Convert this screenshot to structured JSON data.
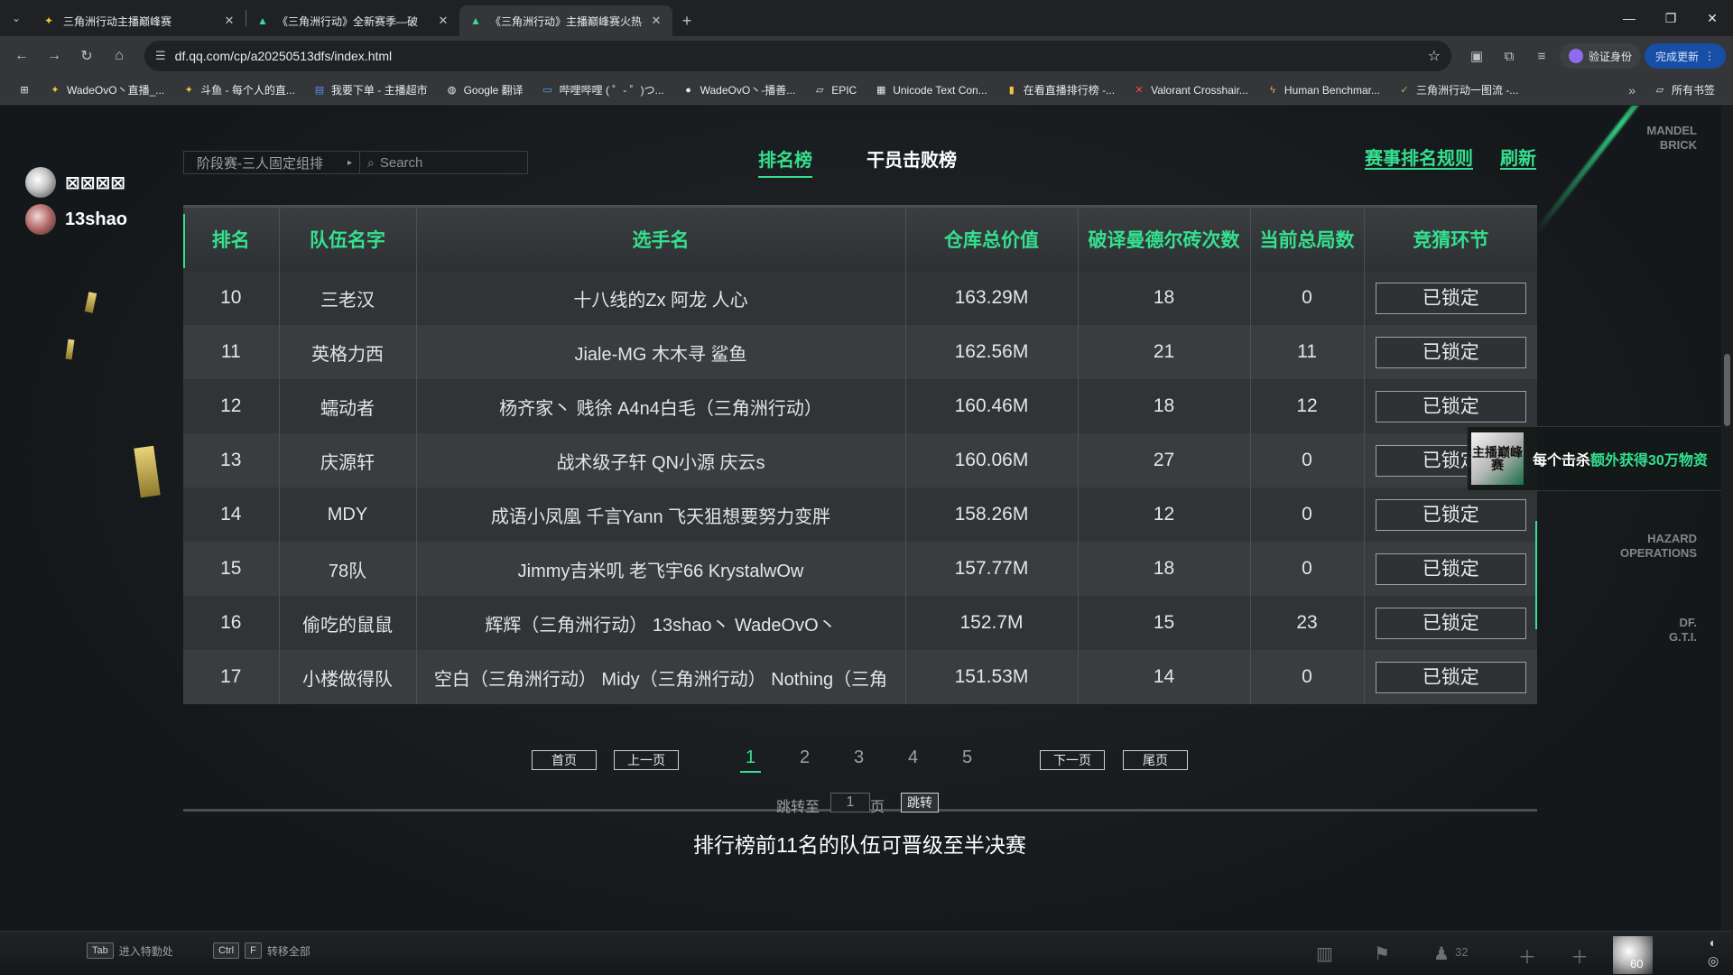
{
  "browser": {
    "tabs": [
      {
        "title": "三角洲行动主播巅峰赛",
        "active": false
      },
      {
        "title": "《三角洲行动》全新赛季—破",
        "active": false
      },
      {
        "title": "《三角洲行动》主播巅峰赛火热",
        "active": true
      }
    ],
    "url": "df.qq.com/cp/a20250513dfs/index.html",
    "profile_label": "验证身份",
    "update_label": "完成更新",
    "bookmarks": [
      "WadeOvO丶直播_...",
      "斗鱼 - 每个人的直...",
      "我要下单 - 主播超市",
      "Google 翻译",
      "哔哩哔哩 ( ゜- ゜)つ...",
      "WadeOvO丶-播善...",
      "EPIC",
      "Unicode Text Con...",
      "在看直播排行榜 -...",
      "Valorant Crosshair...",
      "Human Benchmar...",
      "三角洲行动一图流 -..."
    ],
    "bookmarks_folder": "所有书签"
  },
  "overlay": {
    "users": [
      "⊠⊠⊠⊠",
      "13shao"
    ]
  },
  "filter": {
    "select_label": "阶段赛-三人固定组排",
    "search_placeholder": "Search"
  },
  "tabs": {
    "leaderboard": "排名榜",
    "kills": "干员击败榜"
  },
  "links": {
    "rules": "赛事排名规则",
    "refresh": "刷新"
  },
  "table": {
    "headers": [
      "排名",
      "队伍名字",
      "选手名",
      "仓库总价值",
      "破译曼德尔砖次数",
      "当前总局数",
      "竞猜环节"
    ],
    "rows": [
      {
        "rank": "10",
        "team": "三老汉",
        "players": "十八线的Zx  阿龙  人心",
        "value": "163.29M",
        "bricks": "18",
        "games": "0",
        "status": "已锁定"
      },
      {
        "rank": "11",
        "team": "英格力西",
        "players": "Jiale-MG  木木寻  鲨鱼",
        "value": "162.56M",
        "bricks": "21",
        "games": "11",
        "status": "已锁定"
      },
      {
        "rank": "12",
        "team": "蠕动者",
        "players": "杨齐家丶  贱徐  A4n4白毛（三角洲行动）",
        "value": "160.46M",
        "bricks": "18",
        "games": "12",
        "status": "已锁定"
      },
      {
        "rank": "13",
        "team": "庆源轩",
        "players": "战术级子轩  QN小源  庆云s",
        "value": "160.06M",
        "bricks": "27",
        "games": "0",
        "status": "已锁定"
      },
      {
        "rank": "14",
        "team": "MDY",
        "players": "成语小凤凰  千言Yann  飞天狙想要努力变胖",
        "value": "158.26M",
        "bricks": "12",
        "games": "0",
        "status": "已锁定"
      },
      {
        "rank": "15",
        "team": "78队",
        "players": "Jimmy吉米叽  老飞宇66  KrystalwOw",
        "value": "157.77M",
        "bricks": "18",
        "games": "0",
        "status": "已锁定"
      },
      {
        "rank": "16",
        "team": "偷吃的鼠鼠",
        "players": "辉辉（三角洲行动）  13shao丶  WadeOvO丶",
        "value": "152.7M",
        "bricks": "15",
        "games": "23",
        "status": "已锁定"
      },
      {
        "rank": "17",
        "team": "小楼做得队",
        "players": "空白（三角洲行动）  Midy（三角洲行动）  Nothing（三角",
        "value": "151.53M",
        "bricks": "14",
        "games": "0",
        "status": "已锁定"
      }
    ]
  },
  "pagination": {
    "first": "首页",
    "prev": "上一页",
    "pages": [
      "1",
      "2",
      "3",
      "4",
      "5"
    ],
    "current": "1",
    "next": "下一页",
    "last": "尾页",
    "jump_label": "跳转至",
    "jump_value": "1",
    "page_unit": "页",
    "jump_button": "跳转"
  },
  "notice": "排行榜前11名的队伍可晋级至半决赛",
  "banner": {
    "logo_text": "主播巅峰赛",
    "text_prefix": "每个击杀",
    "text_highlight": "额外获得30万物资"
  },
  "side_labels": {
    "top": "MANDEL BRICK",
    "middle": "HAZARD OPERATIONS",
    "bottom": "DF. G.T.I."
  },
  "hud": {
    "key1": "Tab",
    "key1_label": "进入特勤处",
    "key2a": "Ctrl",
    "key2b": "F",
    "key2_label": "转移全部",
    "player_count": "32",
    "fps": "60"
  },
  "colors": {
    "accent": "#34e08f",
    "row_odd": "#313436",
    "row_even": "#3a3d3f"
  }
}
